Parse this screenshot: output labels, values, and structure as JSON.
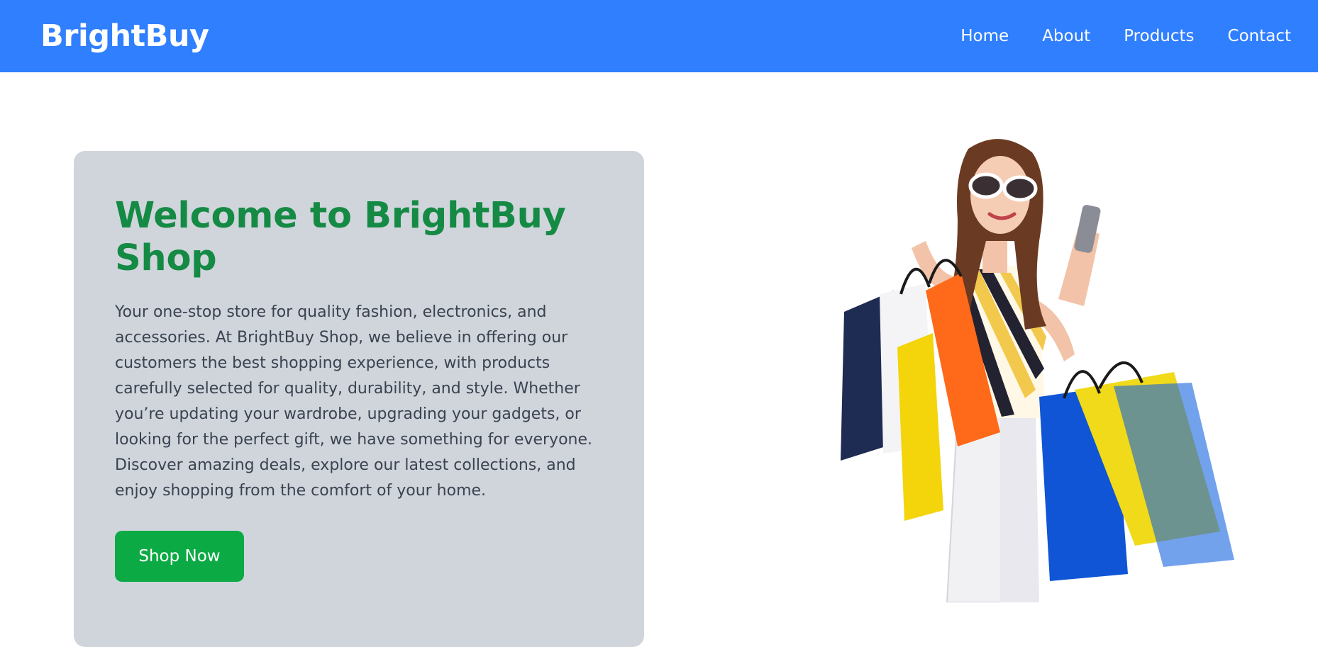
{
  "header": {
    "brand": "BrightBuy",
    "nav": [
      {
        "label": "Home"
      },
      {
        "label": "About"
      },
      {
        "label": "Products"
      },
      {
        "label": "Contact"
      }
    ]
  },
  "hero": {
    "title": "Welcome to BrightBuy Shop",
    "description": "Your one-stop store for quality fashion, electronics, and accessories. At BrightBuy Shop, we believe in offering our customers the best shopping experience, with products carefully selected for quality, durability, and style. Whether you’re updating your wardrobe, upgrading your gadgets, or looking for the perfect gift, we have something for everyone. Discover amazing deals, explore our latest collections, and enjoy shopping from the comfort of your home.",
    "button_label": "Shop Now"
  },
  "colors": {
    "navbar": "#2f7fff",
    "title": "#158a44",
    "button": "#0caa44",
    "card": "#d0d5dc"
  },
  "image": {
    "subject": "woman-with-shopping-bags"
  }
}
